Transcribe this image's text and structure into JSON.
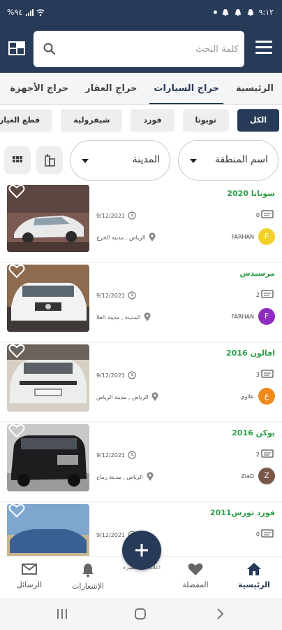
{
  "status_bar": {
    "time": "٩:١٢",
    "battery": "%٩٤"
  },
  "header": {
    "search_placeholder": "كلمة البحث"
  },
  "tabs": [
    {
      "label": "الرئيسية",
      "active": false
    },
    {
      "label": "حراج السيارات",
      "active": true
    },
    {
      "label": "حراج العقار",
      "active": false
    },
    {
      "label": "حراج الأجهزة",
      "active": false
    }
  ],
  "chips": [
    {
      "label": "الكل",
      "active": true
    },
    {
      "label": "تويوتا",
      "active": false
    },
    {
      "label": "فورد",
      "active": false
    },
    {
      "label": "شيفرولية",
      "active": false
    },
    {
      "label": "قطع الغيار",
      "active": false
    }
  ],
  "filters": {
    "region_label": "اسم المنطقة",
    "city_label": "المدينة"
  },
  "listings": [
    {
      "title": "سوناتا 2020",
      "comments": "0",
      "date": "9/12/2021",
      "location": "الرياض , مدينة الخرج",
      "user": "FARHAN",
      "avatar_letter": "F",
      "avatar_color": "#f2d22a"
    },
    {
      "title": "مرسيدس",
      "comments": "2",
      "date": "9/12/2021",
      "location": "المدينة , مدينة العلا",
      "user": "FARHAN",
      "avatar_letter": "F",
      "avatar_color": "#8e2cbf"
    },
    {
      "title": "افالون 2016",
      "comments": "3",
      "date": "9/12/2021",
      "location": "الرياض , مدينة الرياض",
      "user": "علاوي",
      "avatar_letter": "ع",
      "avatar_color": "#f08a1d"
    },
    {
      "title": "يوكن 2016",
      "comments": "2",
      "date": "9/12/2021",
      "location": "الرياض , مدينة رماح",
      "user": "ZiaD",
      "avatar_letter": "Z",
      "avatar_color": "#7a5647"
    },
    {
      "title": "فورد تورس2011",
      "comments": "0",
      "date": "9/12/2021",
      "location": "",
      "user": "",
      "avatar_letter": "",
      "avatar_color": "#cccccc"
    }
  ],
  "bottom_nav": {
    "home": "الرئيسية",
    "favorites": "المفضلة",
    "add_label": "اعلانات المتميزة",
    "notifications": "الإشعارات",
    "messages": "الرسائل"
  },
  "colors": {
    "primary": "#273a58",
    "title_green": "#2e9e48"
  }
}
